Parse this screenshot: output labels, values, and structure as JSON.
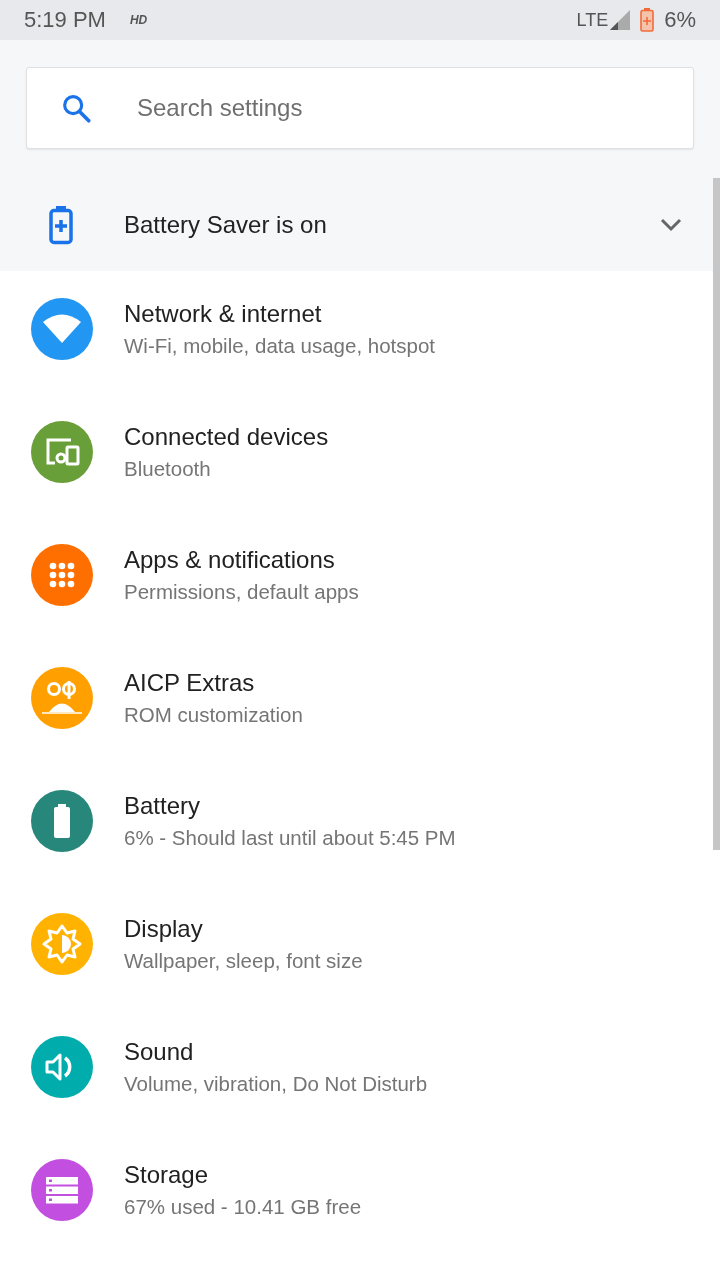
{
  "status_bar": {
    "time": "5:19 PM",
    "hd": "HD",
    "network": "LTE",
    "battery": "6%"
  },
  "search": {
    "placeholder": "Search settings"
  },
  "suggestion": {
    "title": "Battery Saver is on"
  },
  "items": [
    {
      "kind": "wifi",
      "color": "#2196f3",
      "title": "Network & internet",
      "subtitle": "Wi-Fi, mobile, data usage, hotspot"
    },
    {
      "kind": "devices",
      "color": "#689f38",
      "title": "Connected devices",
      "subtitle": "Bluetooth"
    },
    {
      "kind": "apps",
      "color": "#ff6f00",
      "title": "Apps & notifications",
      "subtitle": "Permissions, default apps"
    },
    {
      "kind": "extras",
      "color": "#ffa000",
      "title": "AICP Extras",
      "subtitle": "ROM customization"
    },
    {
      "kind": "battery",
      "color": "#26877a",
      "title": "Battery",
      "subtitle": "6% - Should last until about 5:45 PM"
    },
    {
      "kind": "display",
      "color": "#ffb300",
      "title": "Display",
      "subtitle": "Wallpaper, sleep, font size"
    },
    {
      "kind": "sound",
      "color": "#00acac",
      "title": "Sound",
      "subtitle": "Volume, vibration, Do Not Disturb"
    },
    {
      "kind": "storage",
      "color": "#c24fe0",
      "title": "Storage",
      "subtitle": "67% used - 10.41 GB free"
    }
  ]
}
